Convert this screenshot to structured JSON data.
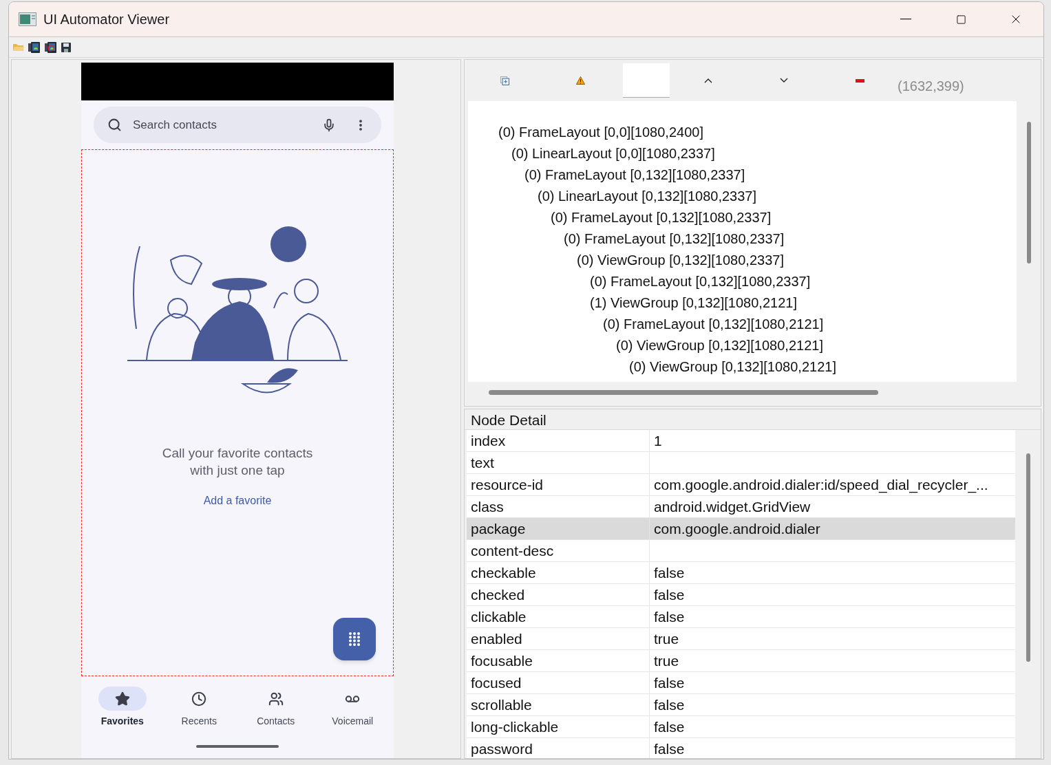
{
  "window": {
    "title": "UI Automator Viewer"
  },
  "phone": {
    "search": {
      "placeholder": "Search contacts"
    },
    "message": "Call your favorite contacts with just one tap",
    "link": "Add a favorite",
    "nav": [
      {
        "label": "Favorites",
        "kind": "star",
        "selected": true
      },
      {
        "label": "Recents",
        "kind": "clock",
        "selected": false
      },
      {
        "label": "Contacts",
        "kind": "people",
        "selected": false
      },
      {
        "label": "Voicemail",
        "kind": "voicemail",
        "selected": false
      }
    ]
  },
  "tree_toolbar": {
    "coordinates": "(1632,399)"
  },
  "tree": [
    {
      "label": "(0) FrameLayout [0,0][1080,2400]",
      "children": [
        {
          "label": "(0) LinearLayout [0,0][1080,2337]",
          "children": [
            {
              "label": "(0) FrameLayout [0,132][1080,2337]",
              "children": [
                {
                  "label": "(0) LinearLayout [0,132][1080,2337]",
                  "children": [
                    {
                      "label": "(0) FrameLayout [0,132][1080,2337]",
                      "children": [
                        {
                          "label": "(0) FrameLayout [0,132][1080,2337]",
                          "children": [
                            {
                              "label": "(0) ViewGroup [0,132][1080,2337]",
                              "children": [
                                {
                                  "label": "(0) FrameLayout [0,132][1080,2337]"
                                },
                                {
                                  "label": "(1) ViewGroup [0,132][1080,2121]",
                                  "children": [
                                    {
                                      "label": "(0) FrameLayout [0,132][1080,2121]",
                                      "children": [
                                        {
                                          "label": "(0) ViewGroup [0,132][1080,2121]",
                                          "children": [
                                            {
                                              "label": "(0) ViewGroup [0,132][1080,2121]"
                                            }
                                          ]
                                        }
                                      ]
                                    }
                                  ]
                                }
                              ]
                            }
                          ]
                        }
                      ]
                    }
                  ]
                }
              ]
            }
          ]
        }
      ]
    }
  ],
  "node_detail": {
    "title": "Node Detail",
    "rows": [
      {
        "key": "index",
        "value": "1",
        "selected": false
      },
      {
        "key": "text",
        "selected": false
      },
      {
        "key": "resource-id",
        "value": "com.google.android.dialer:id/speed_dial_recycler_...",
        "selected": false
      },
      {
        "key": "class",
        "value": "android.widget.GridView",
        "selected": false
      },
      {
        "key": "package",
        "value": "com.google.android.dialer",
        "selected": true
      },
      {
        "key": "content-desc",
        "selected": false
      },
      {
        "key": "checkable",
        "value": "false",
        "selected": false
      },
      {
        "key": "checked",
        "value": "false",
        "selected": false
      },
      {
        "key": "clickable",
        "value": "false",
        "selected": false
      },
      {
        "key": "enabled",
        "value": "true",
        "selected": false
      },
      {
        "key": "focusable",
        "value": "true",
        "selected": false
      },
      {
        "key": "focused",
        "value": "false",
        "selected": false
      },
      {
        "key": "scrollable",
        "value": "false",
        "selected": false
      },
      {
        "key": "long-clickable",
        "value": "false",
        "selected": false
      },
      {
        "key": "password",
        "value": "false",
        "selected": false
      }
    ]
  }
}
